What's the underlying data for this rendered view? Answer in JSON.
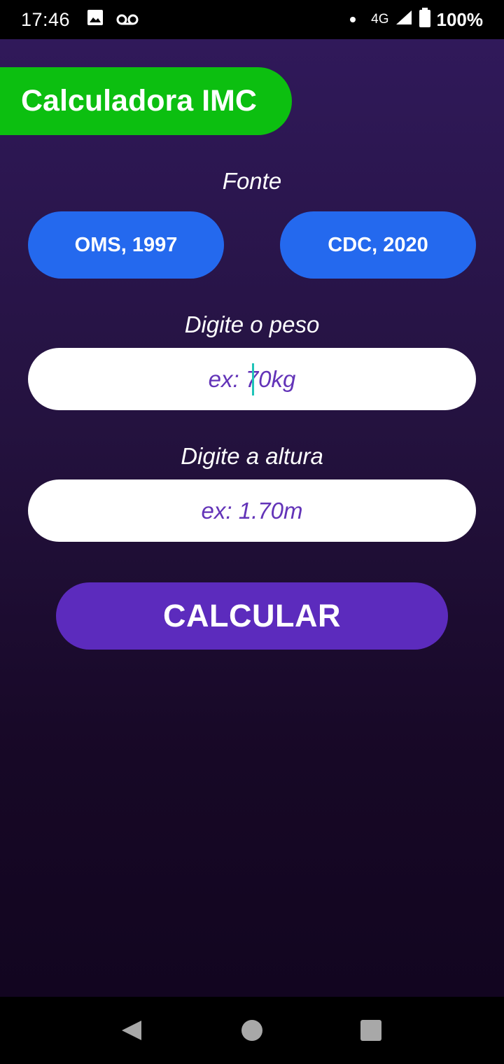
{
  "status_bar": {
    "time": "17:46",
    "left_icons": [
      "image-icon",
      "voicemail-icon"
    ],
    "network": "4G",
    "battery": "100%"
  },
  "app": {
    "title": "Calculadora IMC",
    "source_label": "Fonte",
    "source_buttons": [
      "OMS, 1997",
      "CDC, 2020"
    ],
    "weight_label": "Digite o peso",
    "weight_placeholder": "ex: 70kg",
    "weight_value": "",
    "height_label": "Digite a altura",
    "height_placeholder": "ex: 1.70m",
    "height_value": "",
    "calculate_label": "CALCULAR"
  },
  "colors": {
    "title_bg": "#0cbf10",
    "source_button_bg": "#2469ee",
    "calculate_button_bg": "#5c2bbd",
    "placeholder_text": "#6334b8",
    "background_top": "#30195a",
    "background_bottom": "#120520"
  },
  "nav_bar": {
    "icons": [
      "back-icon",
      "home-icon",
      "recents-icon"
    ]
  }
}
